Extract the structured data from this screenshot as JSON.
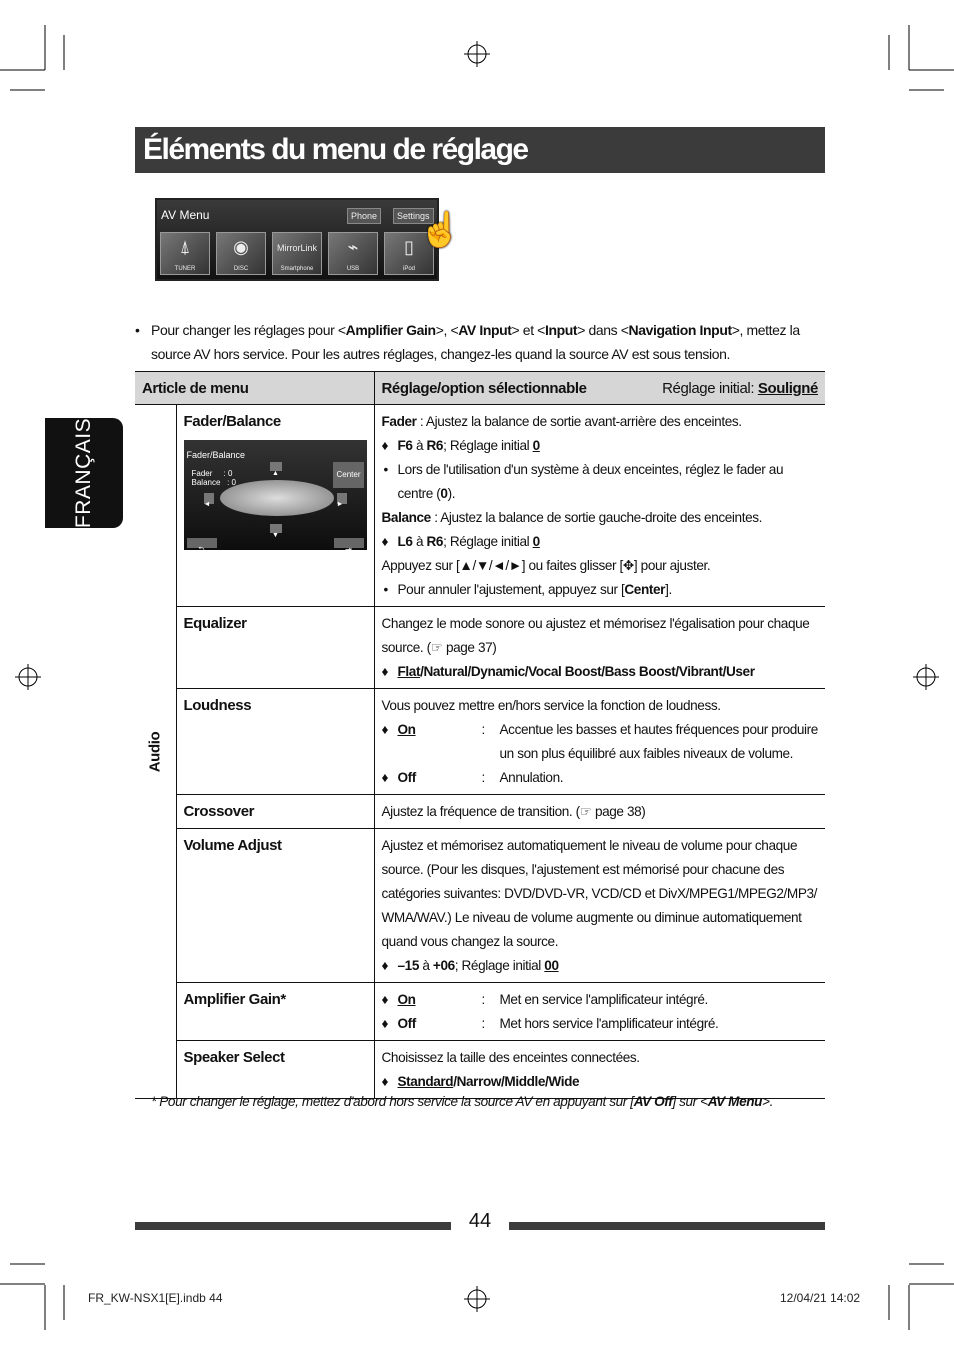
{
  "page_title": "Éléments du menu de réglage",
  "side_tab": "FRANÇAIS",
  "av_menu": {
    "title": "AV Menu",
    "phone": "Phone",
    "settings": "Settings",
    "tiles": [
      "TUNER",
      "DISC",
      "Smartphone",
      "USB",
      "iPod"
    ],
    "mirrorlink": "MirrorLink"
  },
  "intro": [
    {
      "t": "Pour changer les réglages pour <"
    },
    {
      "t": "Amplifier Gain",
      "b": true
    },
    {
      "t": ">, <"
    },
    {
      "t": "AV Input",
      "b": true
    },
    {
      "t": "> et <"
    },
    {
      "t": "Input",
      "b": true
    },
    {
      "t": "> dans <"
    },
    {
      "t": "Navigation Input",
      "b": true
    },
    {
      "t": ">, mettez la source AV hors service. Pour les autres réglages, changez-les quand la source AV est sous tension."
    }
  ],
  "table": {
    "headers": {
      "item": "Article de menu",
      "setting": "Réglage/option sélectionnable",
      "initial_label": "Réglage initial: ",
      "initial_value": "Souligné"
    },
    "category": "Audio",
    "fader_screen": {
      "title": "Fader/Balance",
      "fader": "Fader     : 0",
      "balance": "Balance   : 0",
      "center": "Center"
    },
    "rows": [
      {
        "item": "Fader/Balance",
        "h": 199,
        "lines": [
          {
            "k": "p",
            "s": [
              {
                "t": "Fader",
                "b": true
              },
              {
                "t": " : Ajustez la balance de sortie avant-arrière des enceintes."
              }
            ]
          },
          {
            "k": "dia",
            "s": [
              {
                "t": "F6",
                "b": true
              },
              {
                "t": " à "
              },
              {
                "t": "R6",
                "b": true
              },
              {
                "t": "; Réglage initial "
              },
              {
                "t": "0",
                "b": true,
                "u": true
              }
            ]
          },
          {
            "k": "bul",
            "s": [
              {
                "t": "Lors de l'utilisation d'un système à deux enceintes, réglez le fader au centre ("
              },
              {
                "t": "0",
                "b": true
              },
              {
                "t": ")."
              }
            ]
          },
          {
            "k": "p",
            "s": [
              {
                "t": "Balance",
                "b": true
              },
              {
                "t": " : Ajustez la balance de sortie gauche-droite des enceintes."
              }
            ]
          },
          {
            "k": "dia",
            "s": [
              {
                "t": "L6",
                "b": true
              },
              {
                "t": " à "
              },
              {
                "t": "R6",
                "b": true
              },
              {
                "t": "; Réglage initial "
              },
              {
                "t": "0",
                "b": true,
                "u": true
              }
            ]
          },
          {
            "k": "p",
            "s": [
              {
                "t": "Appuyez sur [▲/▼/◄/►] ou faites glisser [✥] pour ajuster."
              }
            ]
          },
          {
            "k": "bul",
            "s": [
              {
                "t": "Pour annuler l'ajustement, appuyez sur ["
              },
              {
                "t": "Center",
                "b": true
              },
              {
                "t": "]."
              }
            ]
          }
        ]
      },
      {
        "item": "Equalizer",
        "h": 81,
        "lines": [
          {
            "k": "p",
            "s": [
              {
                "t": "Changez le mode sonore ou ajustez et mémorisez l'égalisation pour chaque source. (☞ page 37)"
              }
            ]
          },
          {
            "k": "dia",
            "s": [
              {
                "t": "Flat",
                "b": true,
                "u": true
              },
              {
                "t": "/Natural/Dynamic/Vocal Boost/Bass Boost/Vibrant/User",
                "b": true
              }
            ]
          }
        ]
      },
      {
        "item": "Loudness",
        "h": 104,
        "lines": [
          {
            "k": "p",
            "s": [
              {
                "t": "Vous pouvez mettre en/hors service la fonction de loudness."
              }
            ]
          },
          {
            "k": "opt",
            "label": "On",
            "u": true,
            "desc": "Accentue les basses et hautes fréquences pour produire un son plus équilibré aux faibles niveaux de volume."
          },
          {
            "k": "opt",
            "label": "Off",
            "desc": "Annulation."
          }
        ]
      },
      {
        "item": "Crossover",
        "h": 32,
        "lines": [
          {
            "k": "p",
            "s": [
              {
                "t": "Ajustez la fréquence de transition. (☞ page 38)"
              }
            ]
          }
        ]
      },
      {
        "item": "Volume Adjust",
        "h": 152,
        "lines": [
          {
            "k": "p",
            "s": [
              {
                "t": "Ajustez et mémorisez automatiquement le niveau de volume pour chaque source. (Pour les disques, l'ajustement est mémorisé pour chacune des catégories suivantes: DVD/DVD-VR, VCD/CD et DivX/MPEG1/MPEG2/MP3/ WMA/WAV.) Le niveau de volume augmente ou diminue automatiquement quand vous changez la source."
              }
            ]
          },
          {
            "k": "dia",
            "s": [
              {
                "t": "–15",
                "b": true
              },
              {
                "t": " à "
              },
              {
                "t": "+06",
                "b": true
              },
              {
                "t": "; Réglage initial "
              },
              {
                "t": "00",
                "b": true,
                "u": true
              }
            ]
          }
        ]
      },
      {
        "item": "Amplifier Gain*",
        "h": 56,
        "lines": [
          {
            "k": "opt",
            "label": "On",
            "u": true,
            "desc": "Met en service l'amplificateur intégré."
          },
          {
            "k": "opt",
            "label": "Off",
            "desc": "Met hors service l'amplificateur intégré."
          }
        ]
      },
      {
        "item": "Speaker Select",
        "h": 57,
        "lines": [
          {
            "k": "p",
            "s": [
              {
                "t": "Choisissez la taille des enceintes connectées."
              }
            ]
          },
          {
            "k": "dia",
            "s": [
              {
                "t": "Standard",
                "b": true,
                "u": true
              },
              {
                "t": "/Narrow/Middle/Wide",
                "b": true
              }
            ]
          }
        ]
      }
    ]
  },
  "footnote": [
    {
      "t": "*   Pour changer le réglage, mettez d'abord hors service la source AV en appuyant sur ["
    },
    {
      "t": "AV Off",
      "b": true
    },
    {
      "t": "] sur <"
    },
    {
      "t": "AV Menu",
      "b": true
    },
    {
      "t": ">."
    }
  ],
  "page_number": "44",
  "print_info": {
    "file": "FR_KW-NSX1[E].indb   44",
    "date": "12/04/21   14:02"
  }
}
